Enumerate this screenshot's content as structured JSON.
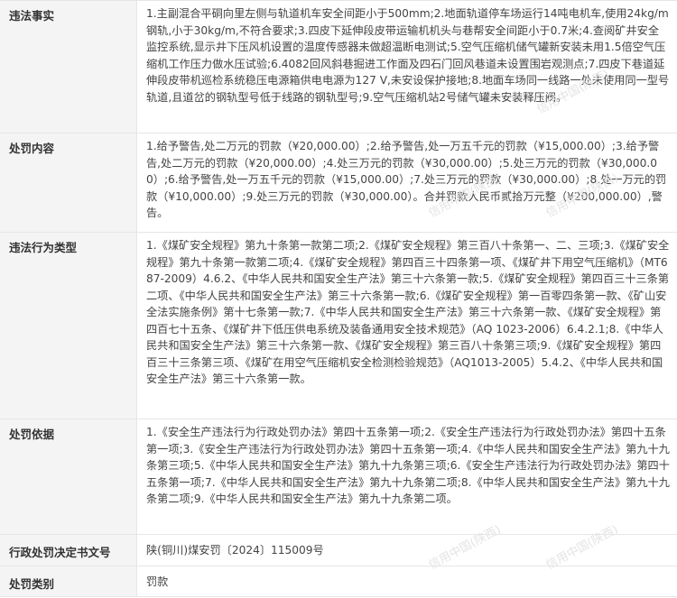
{
  "rows": [
    {
      "label": "违法事实",
      "value": "1.主副混合平硐向里左侧与轨道机车安全间距小于500mm;2.地面轨道停车场运行14吨电机车,使用24kg/m钢轨,小于30kg/m,不符合要求;3.四皮下延伸段皮带运输机机头与巷帮安全间距小于0.7米;4.查阅矿井安全监控系统,显示井下压风机设置的温度传感器未做超温断电测试;5.空气压缩机储气罐新安装未用1.5倍空气压缩机工作压力做水压试验;6.4082回风斜巷掘进工作面及四石门回风巷道未设置围岩观测点;7.四皮下巷道延伸段皮带机巡检系统稳压电源箱供电电源为127 V,未安设保护接地;8.地面车场同一线路一处未使用同一型号轨道,且道岔的钢轨型号低于线路的钢轨型号;9.空气压缩机站2号储气罐未安装释压阀。"
    },
    {
      "label": "处罚内容",
      "value": "1.给予警告,处二万元的罚款（¥20,000.00）;2.给予警告,处一万五千元的罚款（¥15,000.00）;3.给予警告,处二万元的罚款（¥20,000.00）;4.处三万元的罚款（¥30,000.00）;5.处三万元的罚款（¥30,000.00）;6.给予警告,处一万五千元的罚款（¥15,000.00）;7.处三万元的罚款（¥30,000.00）;8.处一万元的罚款（¥10,000.00）;9.处三万元的罚款（¥30,000.00）。合并罚款人民币贰拾万元整（¥200,000.00）,警告。"
    },
    {
      "label": "违法行为类型",
      "value": "1.《煤矿安全规程》第九十条第一款第二项;2.《煤矿安全规程》第三百八十条第一、二、三项;3.《煤矿安全规程》第九十条第一款第二项;4.《煤矿安全规程》第四百三十四条第一项、《煤矿井下用空气压缩机》（MT687-2009）4.6.2、《中华人民共和国安全生产法》第三十六条第一款;5.《煤矿安全规程》第四百三十三条第二项、《中华人民共和国安全生产法》第三十六条第一款;6.《煤矿安全规程》第一百零四条第一款、《矿山安全法实施条例》第十七条第一款;7.《中华人民共和国安全生产法》第三十六条第一款、《煤矿安全规程》第四百七十五条、《煤矿井下低压供电系统及装备通用安全技术规范》（AQ 1023-2006）6.4.2.1;8.《中华人民共和国安全生产法》第三十六条第一款、《煤矿安全规程》第三百八十条第三项;9.《煤矿安全规程》第四百三十三条第三项、《煤矿在用空气压缩机安全检测检验规范》（AQ1013-2005）5.4.2、《中华人民共和国安全生产法》第三十六条第一款。"
    },
    {
      "label": "处罚依据",
      "value": "1.《安全生产违法行为行政处罚办法》第四十五条第一项;2.《安全生产违法行为行政处罚办法》第四十五条第一项;3.《安全生产违法行为行政处罚办法》第四十五条第一项;4.《中华人民共和国安全生产法》第九十九条第三项;5.《中华人民共和国安全生产法》第九十九条第三项;6.《安全生产违法行为行政处罚办法》第四十五条第一项;7.《中华人民共和国安全生产法》第九十九条第二项;8.《中华人民共和国安全生产法》第九十九条第二项;9.《中华人民共和国安全生产法》第九十九条第二项。"
    },
    {
      "label": "行政处罚决定书文号",
      "value": "陕(铜川)煤安罚〔2024〕115009号"
    },
    {
      "label": "处罚类别",
      "value": "罚款"
    }
  ],
  "watermark": "信用中国(陕西)"
}
